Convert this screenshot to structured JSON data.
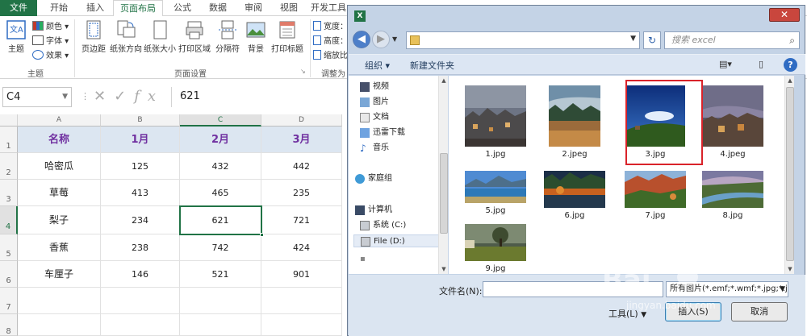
{
  "ribbon": {
    "tabs": [
      "文件",
      "开始",
      "插入",
      "页面布局",
      "公式",
      "数据",
      "审阅",
      "视图",
      "开发工具"
    ],
    "active_tab": "页面布局",
    "theme_group": {
      "theme": "主题",
      "colors": "颜色",
      "fonts": "字体",
      "effects": "效果",
      "label": "主题"
    },
    "page_setup": {
      "margins": "页边距",
      "orientation": "纸张方向",
      "size": "纸张大小",
      "print_area": "打印区域",
      "breaks": "分隔符",
      "background": "背景",
      "print_titles": "打印标题",
      "label": "页面设置"
    },
    "scale": {
      "width": "宽度",
      "height": "高度",
      "scale": "缩放比",
      "label": "调整为"
    }
  },
  "formula_bar": {
    "name_box": "C4",
    "value": "621",
    "fx": "fx"
  },
  "sheet": {
    "columns": [
      "A",
      "B",
      "C",
      "D"
    ],
    "rows": [
      "1",
      "2",
      "3",
      "4",
      "5",
      "6",
      "7",
      "8"
    ],
    "header": [
      "名称",
      "1月",
      "2月",
      "3月"
    ],
    "data": [
      [
        "哈密瓜",
        "125",
        "432",
        "442"
      ],
      [
        "草莓",
        "413",
        "465",
        "235"
      ],
      [
        "梨子",
        "234",
        "621",
        "721"
      ],
      [
        "香蕉",
        "238",
        "742",
        "424"
      ],
      [
        "车厘子",
        "146",
        "521",
        "901"
      ]
    ]
  },
  "dialog": {
    "app_icon": "X",
    "close": "✕",
    "search_placeholder": "搜索 excel",
    "organize": "组织 ▾",
    "new_folder": "新建文件夹",
    "help": "?",
    "nav": {
      "favorites": [
        "视频",
        "图片",
        "文档",
        "迅雷下载",
        "音乐"
      ],
      "homegroup": "家庭组",
      "computer": "计算机",
      "drives": [
        "系统 (C:)",
        "File (D:)"
      ]
    },
    "files": [
      "1.jpg",
      "2.jpeg",
      "3.jpg",
      "4.jpeg",
      "5.jpg",
      "6.jpg",
      "7.jpg",
      "8.jpg",
      "9.jpg"
    ],
    "selected_file": "3.jpg",
    "filename_label": "文件名(N):",
    "filetype": "所有图片(*.emf;*.wmf;*.jpg;*.jp",
    "tools": "工具(L)",
    "insert": "插入(S)",
    "cancel": "取消"
  },
  "watermark": {
    "text": "Bai",
    "sub": "jingyan.baidu.com"
  },
  "colors": {
    "excel_green": "#217346",
    "header_fill": "#dce6f1",
    "header_text": "#7030a0",
    "dialog_frame": "#c4d3e6",
    "selection_red": "#d9232a"
  },
  "icons": [
    "search-icon",
    "refresh-icon",
    "back-icon",
    "forward-icon",
    "folder-icon",
    "help-icon",
    "close-icon",
    "fx-icon",
    "cancel-x-icon",
    "check-icon"
  ]
}
